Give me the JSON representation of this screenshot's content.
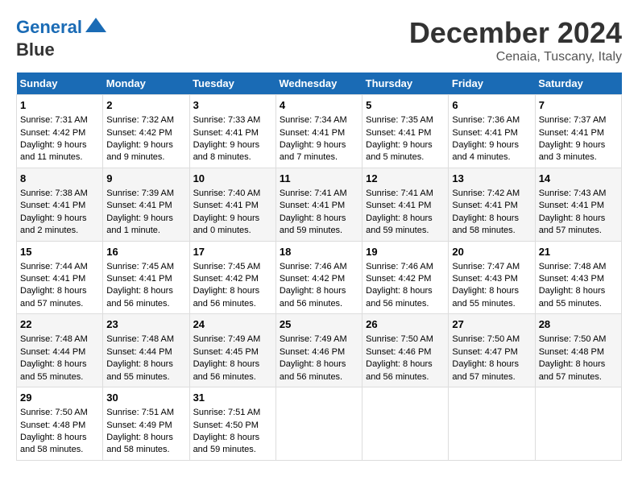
{
  "logo": {
    "line1": "General",
    "line2": "Blue"
  },
  "title": "December 2024",
  "location": "Cenaia, Tuscany, Italy",
  "days_of_week": [
    "Sunday",
    "Monday",
    "Tuesday",
    "Wednesday",
    "Thursday",
    "Friday",
    "Saturday"
  ],
  "weeks": [
    [
      {
        "day": 1,
        "sunrise": "Sunrise: 7:31 AM",
        "sunset": "Sunset: 4:42 PM",
        "daylight": "Daylight: 9 hours and 11 minutes."
      },
      {
        "day": 2,
        "sunrise": "Sunrise: 7:32 AM",
        "sunset": "Sunset: 4:42 PM",
        "daylight": "Daylight: 9 hours and 9 minutes."
      },
      {
        "day": 3,
        "sunrise": "Sunrise: 7:33 AM",
        "sunset": "Sunset: 4:41 PM",
        "daylight": "Daylight: 9 hours and 8 minutes."
      },
      {
        "day": 4,
        "sunrise": "Sunrise: 7:34 AM",
        "sunset": "Sunset: 4:41 PM",
        "daylight": "Daylight: 9 hours and 7 minutes."
      },
      {
        "day": 5,
        "sunrise": "Sunrise: 7:35 AM",
        "sunset": "Sunset: 4:41 PM",
        "daylight": "Daylight: 9 hours and 5 minutes."
      },
      {
        "day": 6,
        "sunrise": "Sunrise: 7:36 AM",
        "sunset": "Sunset: 4:41 PM",
        "daylight": "Daylight: 9 hours and 4 minutes."
      },
      {
        "day": 7,
        "sunrise": "Sunrise: 7:37 AM",
        "sunset": "Sunset: 4:41 PM",
        "daylight": "Daylight: 9 hours and 3 minutes."
      }
    ],
    [
      {
        "day": 8,
        "sunrise": "Sunrise: 7:38 AM",
        "sunset": "Sunset: 4:41 PM",
        "daylight": "Daylight: 9 hours and 2 minutes."
      },
      {
        "day": 9,
        "sunrise": "Sunrise: 7:39 AM",
        "sunset": "Sunset: 4:41 PM",
        "daylight": "Daylight: 9 hours and 1 minute."
      },
      {
        "day": 10,
        "sunrise": "Sunrise: 7:40 AM",
        "sunset": "Sunset: 4:41 PM",
        "daylight": "Daylight: 9 hours and 0 minutes."
      },
      {
        "day": 11,
        "sunrise": "Sunrise: 7:41 AM",
        "sunset": "Sunset: 4:41 PM",
        "daylight": "Daylight: 8 hours and 59 minutes."
      },
      {
        "day": 12,
        "sunrise": "Sunrise: 7:41 AM",
        "sunset": "Sunset: 4:41 PM",
        "daylight": "Daylight: 8 hours and 59 minutes."
      },
      {
        "day": 13,
        "sunrise": "Sunrise: 7:42 AM",
        "sunset": "Sunset: 4:41 PM",
        "daylight": "Daylight: 8 hours and 58 minutes."
      },
      {
        "day": 14,
        "sunrise": "Sunrise: 7:43 AM",
        "sunset": "Sunset: 4:41 PM",
        "daylight": "Daylight: 8 hours and 57 minutes."
      }
    ],
    [
      {
        "day": 15,
        "sunrise": "Sunrise: 7:44 AM",
        "sunset": "Sunset: 4:41 PM",
        "daylight": "Daylight: 8 hours and 57 minutes."
      },
      {
        "day": 16,
        "sunrise": "Sunrise: 7:45 AM",
        "sunset": "Sunset: 4:41 PM",
        "daylight": "Daylight: 8 hours and 56 minutes."
      },
      {
        "day": 17,
        "sunrise": "Sunrise: 7:45 AM",
        "sunset": "Sunset: 4:42 PM",
        "daylight": "Daylight: 8 hours and 56 minutes."
      },
      {
        "day": 18,
        "sunrise": "Sunrise: 7:46 AM",
        "sunset": "Sunset: 4:42 PM",
        "daylight": "Daylight: 8 hours and 56 minutes."
      },
      {
        "day": 19,
        "sunrise": "Sunrise: 7:46 AM",
        "sunset": "Sunset: 4:42 PM",
        "daylight": "Daylight: 8 hours and 56 minutes."
      },
      {
        "day": 20,
        "sunrise": "Sunrise: 7:47 AM",
        "sunset": "Sunset: 4:43 PM",
        "daylight": "Daylight: 8 hours and 55 minutes."
      },
      {
        "day": 21,
        "sunrise": "Sunrise: 7:48 AM",
        "sunset": "Sunset: 4:43 PM",
        "daylight": "Daylight: 8 hours and 55 minutes."
      }
    ],
    [
      {
        "day": 22,
        "sunrise": "Sunrise: 7:48 AM",
        "sunset": "Sunset: 4:44 PM",
        "daylight": "Daylight: 8 hours and 55 minutes."
      },
      {
        "day": 23,
        "sunrise": "Sunrise: 7:48 AM",
        "sunset": "Sunset: 4:44 PM",
        "daylight": "Daylight: 8 hours and 55 minutes."
      },
      {
        "day": 24,
        "sunrise": "Sunrise: 7:49 AM",
        "sunset": "Sunset: 4:45 PM",
        "daylight": "Daylight: 8 hours and 56 minutes."
      },
      {
        "day": 25,
        "sunrise": "Sunrise: 7:49 AM",
        "sunset": "Sunset: 4:46 PM",
        "daylight": "Daylight: 8 hours and 56 minutes."
      },
      {
        "day": 26,
        "sunrise": "Sunrise: 7:50 AM",
        "sunset": "Sunset: 4:46 PM",
        "daylight": "Daylight: 8 hours and 56 minutes."
      },
      {
        "day": 27,
        "sunrise": "Sunrise: 7:50 AM",
        "sunset": "Sunset: 4:47 PM",
        "daylight": "Daylight: 8 hours and 57 minutes."
      },
      {
        "day": 28,
        "sunrise": "Sunrise: 7:50 AM",
        "sunset": "Sunset: 4:48 PM",
        "daylight": "Daylight: 8 hours and 57 minutes."
      }
    ],
    [
      {
        "day": 29,
        "sunrise": "Sunrise: 7:50 AM",
        "sunset": "Sunset: 4:48 PM",
        "daylight": "Daylight: 8 hours and 58 minutes."
      },
      {
        "day": 30,
        "sunrise": "Sunrise: 7:51 AM",
        "sunset": "Sunset: 4:49 PM",
        "daylight": "Daylight: 8 hours and 58 minutes."
      },
      {
        "day": 31,
        "sunrise": "Sunrise: 7:51 AM",
        "sunset": "Sunset: 4:50 PM",
        "daylight": "Daylight: 8 hours and 59 minutes."
      },
      null,
      null,
      null,
      null
    ]
  ]
}
